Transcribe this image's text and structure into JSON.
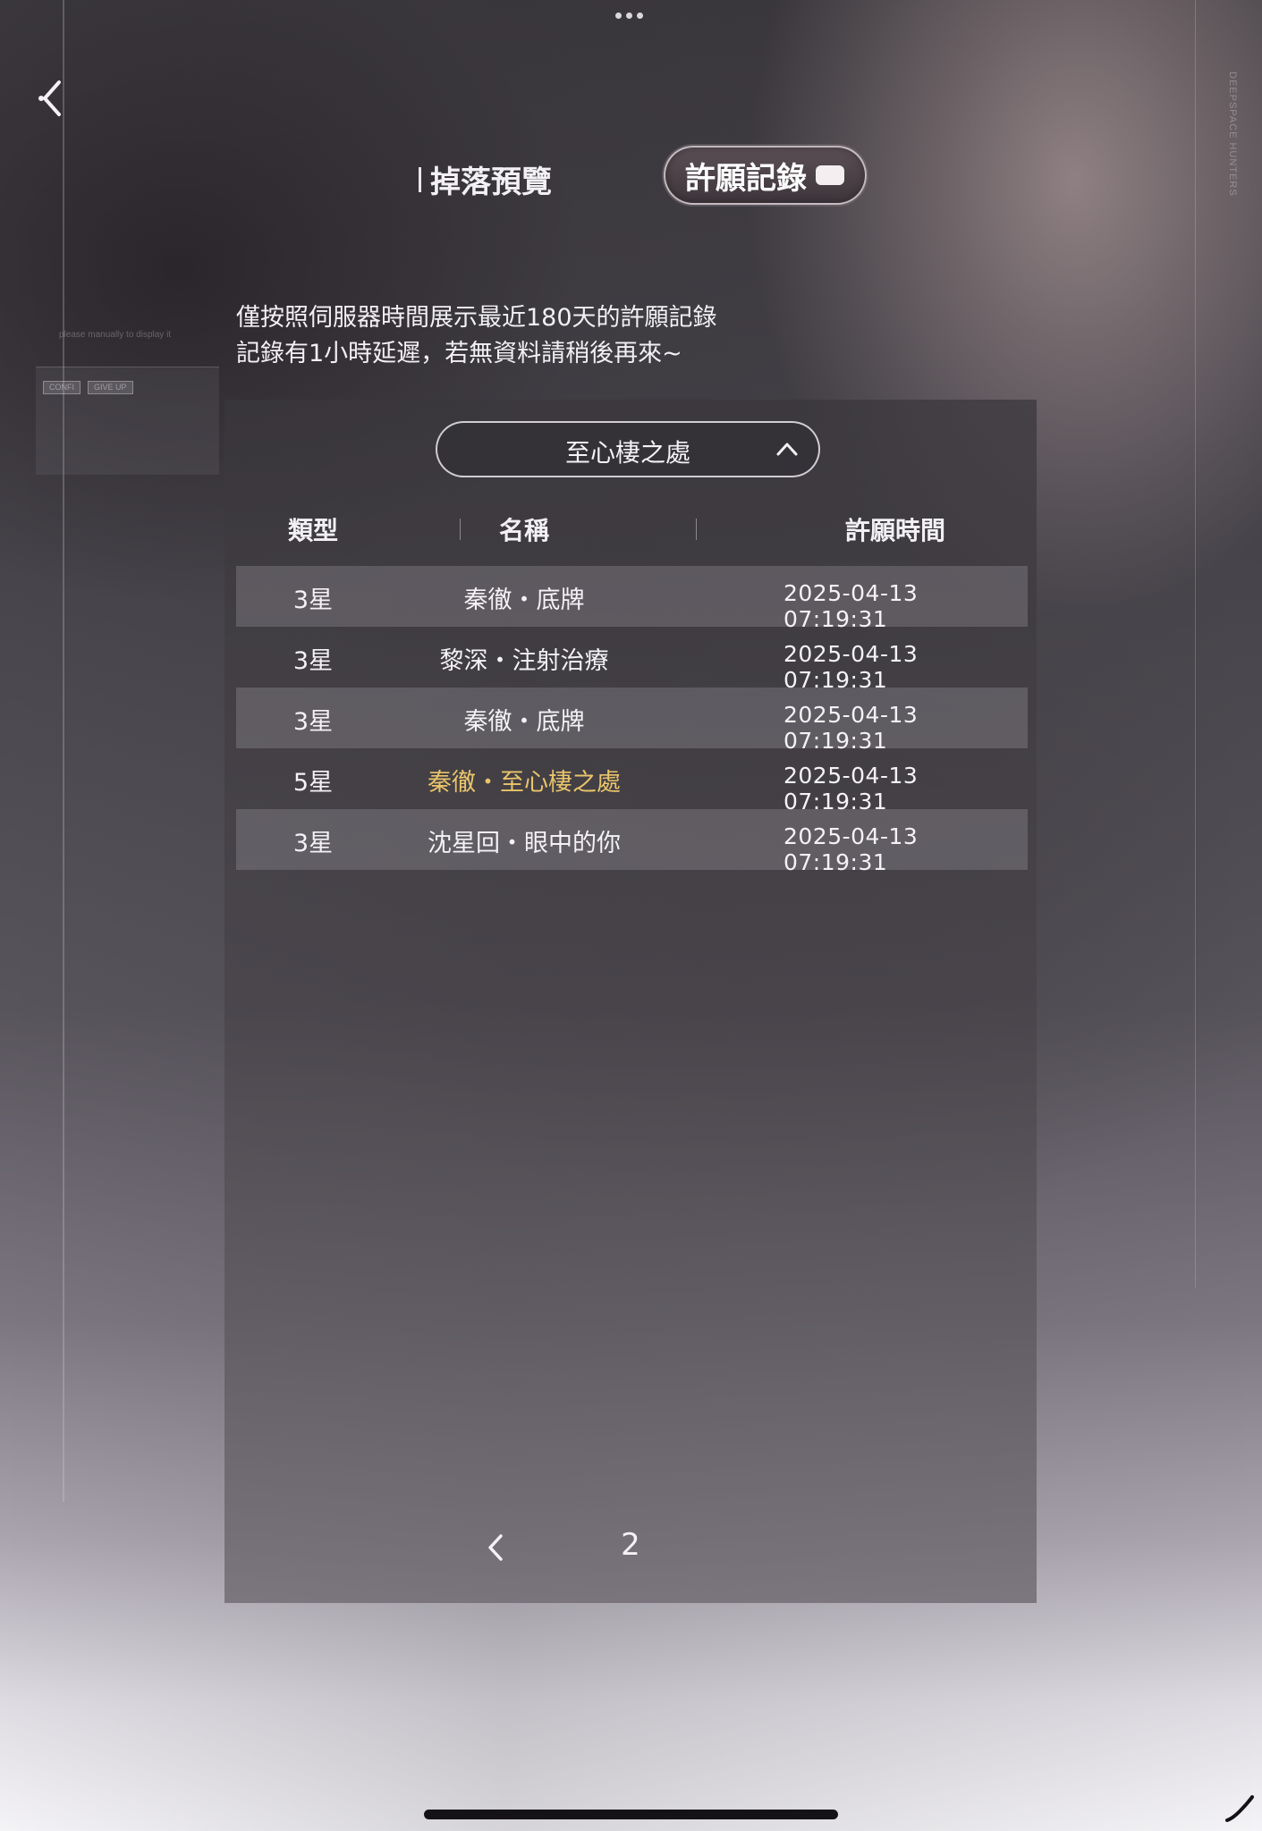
{
  "tabs": {
    "drop_preview": "掉落預覽",
    "wish_record": "許願記錄"
  },
  "side_text": "DEEPSPACE HUNTERS",
  "left_panel": {
    "caption": "please manually to display it",
    "buttons": [
      "CONFI",
      "GIVE UP"
    ]
  },
  "notice": {
    "line1": "僅按照伺服器時間展示最近180天的許願記錄",
    "line2": "記錄有1小時延遲，若無資料請稍後再來~"
  },
  "banner_select": {
    "selected": "至心棲之處"
  },
  "table": {
    "headers": {
      "type": "類型",
      "name": "名稱",
      "time": "許願時間"
    },
    "rows": [
      {
        "type": "3星",
        "name": "秦徹・底牌",
        "time": "2025-04-13 07:19:31"
      },
      {
        "type": "3星",
        "name": "黎深・注射治療",
        "time": "2025-04-13 07:19:31"
      },
      {
        "type": "3星",
        "name": "秦徹・底牌",
        "time": "2025-04-13 07:19:31"
      },
      {
        "type": "5星",
        "name": "秦徹・至心棲之處",
        "time": "2025-04-13 07:19:31"
      },
      {
        "type": "3星",
        "name": "沈星回・眼中的你",
        "time": "2025-04-13 07:19:31"
      }
    ]
  },
  "pager": {
    "current_page": "2"
  },
  "colors": {
    "five_star": "#e9c46a",
    "text": "#f4f2f6"
  },
  "icons": {
    "back": "back-arrow-icon",
    "select": "chevron-up-icon",
    "prev_page": "chevron-left-icon"
  }
}
